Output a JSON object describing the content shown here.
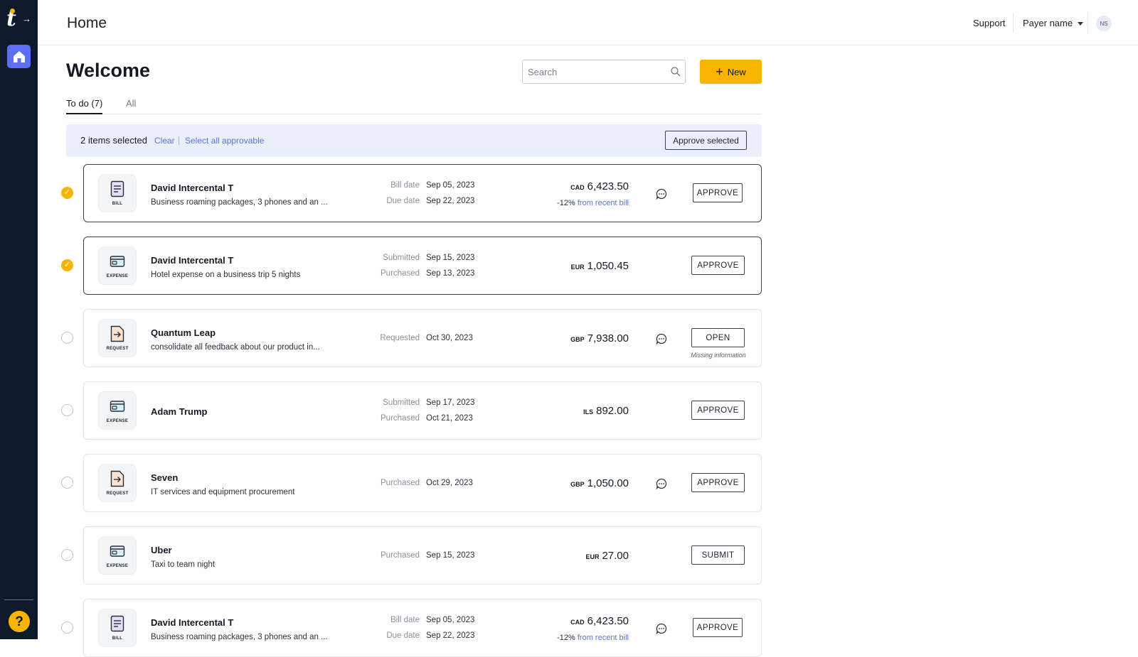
{
  "header": {
    "title": "Home",
    "support": "Support",
    "payer": "Payer name",
    "avatar": "NS"
  },
  "main": {
    "welcome": "Welcome",
    "search_placeholder": "Search",
    "new_label": "New",
    "tabs": [
      {
        "label": "To do (7)",
        "active": true
      },
      {
        "label": "All",
        "active": false
      }
    ],
    "selection": {
      "count_text": "2 items selected",
      "clear": "Clear",
      "select_all": "Select all approvable",
      "approve_selected": "Approve selected"
    },
    "items": [
      {
        "type": "BILL",
        "selected": true,
        "name": "David Intercental T",
        "desc": "Business roaming packages, 3 phones and an ...",
        "d1_label": "Bill date",
        "d1_value": "Sep 05, 2023",
        "d2_label": "Due date",
        "d2_value": "Sep 22, 2023",
        "currency": "CAD",
        "amount": "6,423.50",
        "delta": "-12%",
        "delta_link": "from recent bill",
        "comment": true,
        "action": "APPROVE"
      },
      {
        "type": "EXPENSE",
        "selected": true,
        "name": "David Intercental T",
        "desc": "Hotel expense on a business trip 5 nights",
        "d1_label": "Submitted",
        "d1_value": "Sep 15, 2023",
        "d2_label": "Purchased",
        "d2_value": "Sep 13, 2023",
        "currency": "EUR",
        "amount": "1,050.45",
        "comment": false,
        "action": "APPROVE"
      },
      {
        "type": "REQUEST",
        "selected": false,
        "name": "Quantum Leap",
        "desc": "consolidate all feedback about our product in...",
        "d1_label": "Requested",
        "d1_value": "Oct 30, 2023",
        "currency": "GBP",
        "amount": "7,938.00",
        "comment": true,
        "action": "OPEN",
        "note": "Missing information"
      },
      {
        "type": "EXPENSE",
        "selected": false,
        "name": "Adam Trump",
        "desc": "",
        "d1_label": "Submitted",
        "d1_value": "Sep 17, 2023",
        "d2_label": "Purchased",
        "d2_value": "Oct 21, 2023",
        "currency": "ILS",
        "amount": "892.00",
        "comment": false,
        "action": "APPROVE"
      },
      {
        "type": "REQUEST",
        "selected": false,
        "name": "Seven",
        "desc": "IT services and equipment procurement",
        "d1_label": "Purchased",
        "d1_value": "Oct 29, 2023",
        "currency": "GBP",
        "amount": "1,050.00",
        "comment": true,
        "action": "APPROVE"
      },
      {
        "type": "EXPENSE",
        "selected": false,
        "name": "Uber",
        "desc": "Taxi to team night",
        "d1_label": "Purchased",
        "d1_value": "Sep 15, 2023",
        "currency": "EUR",
        "amount": "27.00",
        "comment": false,
        "action": "SUBMIT"
      },
      {
        "type": "BILL",
        "selected": false,
        "name": "David Intercental T",
        "desc": "Business roaming packages, 3 phones and an ...",
        "d1_label": "Bill date",
        "d1_value": "Sep 05, 2023",
        "d2_label": "Due date",
        "d2_value": "Sep 22, 2023",
        "currency": "CAD",
        "amount": "6,423.50",
        "delta": "-12%",
        "delta_link": "from recent bill",
        "comment": true,
        "action": "APPROVE"
      }
    ]
  },
  "icons": {
    "logo": "tipalti-logo",
    "home": "home-icon",
    "help": "help-icon",
    "search": "search-icon",
    "comment": "comment-icon",
    "bill": "bill-document-icon",
    "expense": "wallet-card-icon",
    "request": "request-arrow-icon"
  },
  "colors": {
    "sidebar": "#0e1a2b",
    "accent": "#f7b500",
    "nav_active": "#5b6ef5",
    "link": "#5a73d6",
    "selection_bg": "#e9f0fb"
  }
}
